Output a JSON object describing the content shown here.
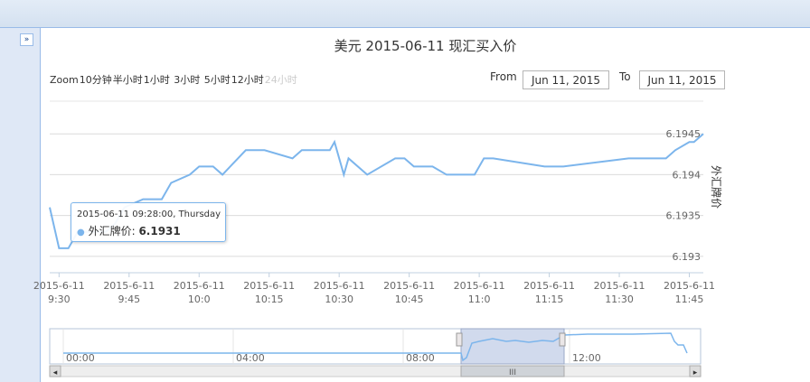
{
  "window": {
    "collapse_icon": "»"
  },
  "header": {
    "title": "美元 2015-06-11 现汇买入价"
  },
  "zoom": {
    "label": "Zoom",
    "buttons": [
      "10分钟",
      "半小时",
      "1小时",
      "3小时",
      "5小时",
      "12小时",
      "24小时"
    ],
    "disabled": [
      "24小时"
    ]
  },
  "range": {
    "from_label": "From",
    "from_value": "Jun 11, 2015",
    "to_label": "To",
    "to_value": "Jun 11, 2015"
  },
  "tooltip": {
    "date": "2015-06-11 09:28:00, Thursday",
    "series": "外汇牌价",
    "value": "6.1931"
  },
  "navigator": {
    "labels": [
      "00:00",
      "04:00",
      "08:00",
      "12:00"
    ],
    "scroll_grip": "III",
    "left_arrow": "◂",
    "right_arrow": "▸"
  },
  "chart_data": {
    "type": "line",
    "title": "美元 2015-06-11 现汇买入价",
    "ylabel": "外汇牌价",
    "ylim": [
      6.1928,
      6.1949
    ],
    "yticks": [
      "6.193",
      "6.1935",
      "6.194",
      "6.1945"
    ],
    "xticks": [
      {
        "l1": "2015-6-11",
        "l2": "9:30"
      },
      {
        "l1": "2015-6-11",
        "l2": "9:45"
      },
      {
        "l1": "2015-6-11",
        "l2": "10:0"
      },
      {
        "l1": "2015-6-11",
        "l2": "10:15"
      },
      {
        "l1": "2015-6-11",
        "l2": "10:30"
      },
      {
        "l1": "2015-6-11",
        "l2": "10:45"
      },
      {
        "l1": "2015-6-11",
        "l2": "11:0"
      },
      {
        "l1": "2015-6-11",
        "l2": "11:15"
      },
      {
        "l1": "2015-6-11",
        "l2": "11:30"
      },
      {
        "l1": "2015-6-11",
        "l2": "11:45"
      }
    ],
    "grid": true,
    "legend": "none",
    "color": "#7cb5ec",
    "series": [
      {
        "name": "外汇牌价",
        "times": [
          "09:28",
          "09:30",
          "09:32",
          "09:34",
          "09:36",
          "09:40",
          "09:42",
          "09:44",
          "09:48",
          "09:52",
          "09:54",
          "09:58",
          "10:00",
          "10:03",
          "10:05",
          "10:10",
          "10:12",
          "10:14",
          "10:20",
          "10:22",
          "10:28",
          "10:29",
          "10:31",
          "10:32",
          "10:36",
          "10:42",
          "10:44",
          "10:46",
          "10:50",
          "10:53",
          "10:59",
          "11:01",
          "11:03",
          "11:14",
          "11:18",
          "11:32",
          "11:38",
          "11:40",
          "11:42",
          "11:45",
          "11:46",
          "11:48"
        ],
        "values": [
          6.1936,
          6.1931,
          6.1931,
          6.1933,
          6.1933,
          6.1933,
          6.1934,
          6.1936,
          6.1937,
          6.1937,
          6.1939,
          6.194,
          6.1941,
          6.1941,
          6.194,
          6.1943,
          6.1943,
          6.1943,
          6.1942,
          6.1943,
          6.1943,
          6.1944,
          6.194,
          6.1942,
          6.194,
          6.1942,
          6.1942,
          6.1941,
          6.1941,
          6.194,
          6.194,
          6.1942,
          6.1942,
          6.1941,
          6.1941,
          6.1942,
          6.1942,
          6.1942,
          6.1943,
          6.1944,
          6.1944,
          6.1945
        ]
      }
    ]
  }
}
